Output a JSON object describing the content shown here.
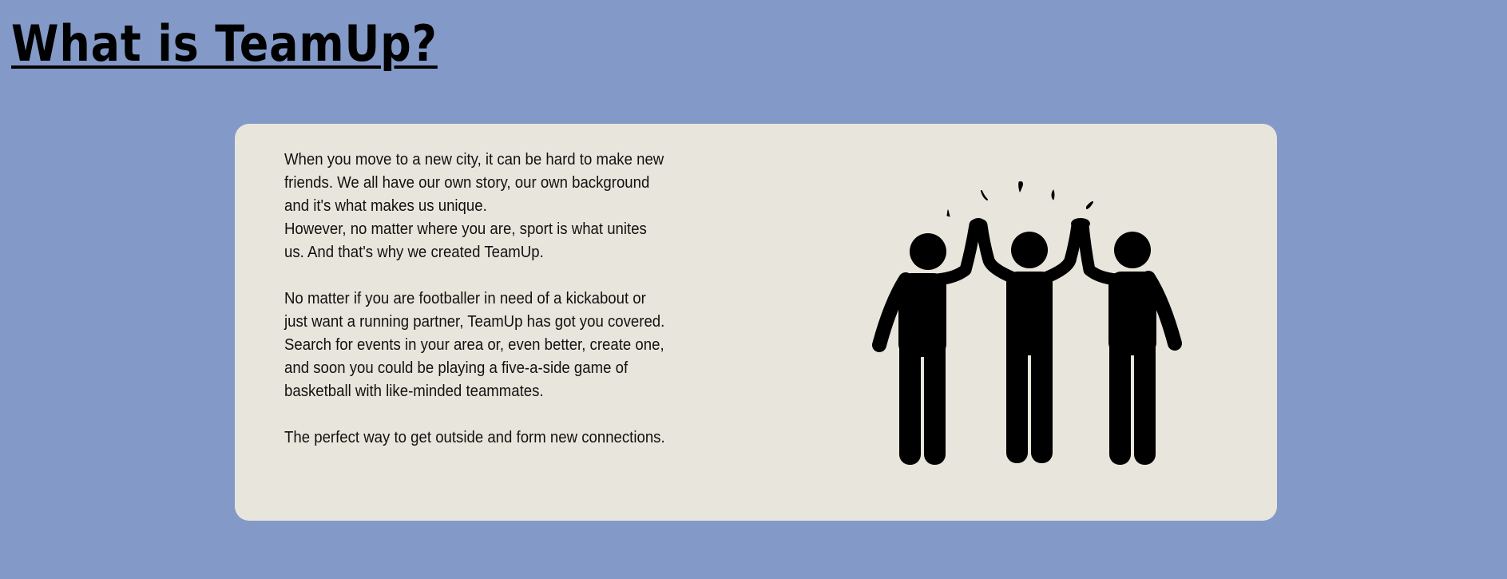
{
  "header": {
    "title": "What is TeamUp?"
  },
  "about": {
    "paragraph1_line1": "When you move to a new city, it can be hard to make new friends. We all have our own story, our own background and it's what makes us unique.",
    "paragraph1_line2": "However, no matter where you are, sport is what unites us. And that's why we created TeamUp.",
    "paragraph2_line1": "No matter if you are footballer in need of a kickabout or just want a running partner, TeamUp has got you covered.",
    "paragraph2_line2": "Search for events in your area or, even better, create one, and soon you could be playing a five-a-side game of basketball with like-minded teammates.",
    "paragraph3": "The perfect way to get outside and form new connections.",
    "illustration_icon": "people-high-five-icon"
  },
  "colors": {
    "background": "#8399c8",
    "card": "#e8e6dc",
    "text": "#000000"
  }
}
